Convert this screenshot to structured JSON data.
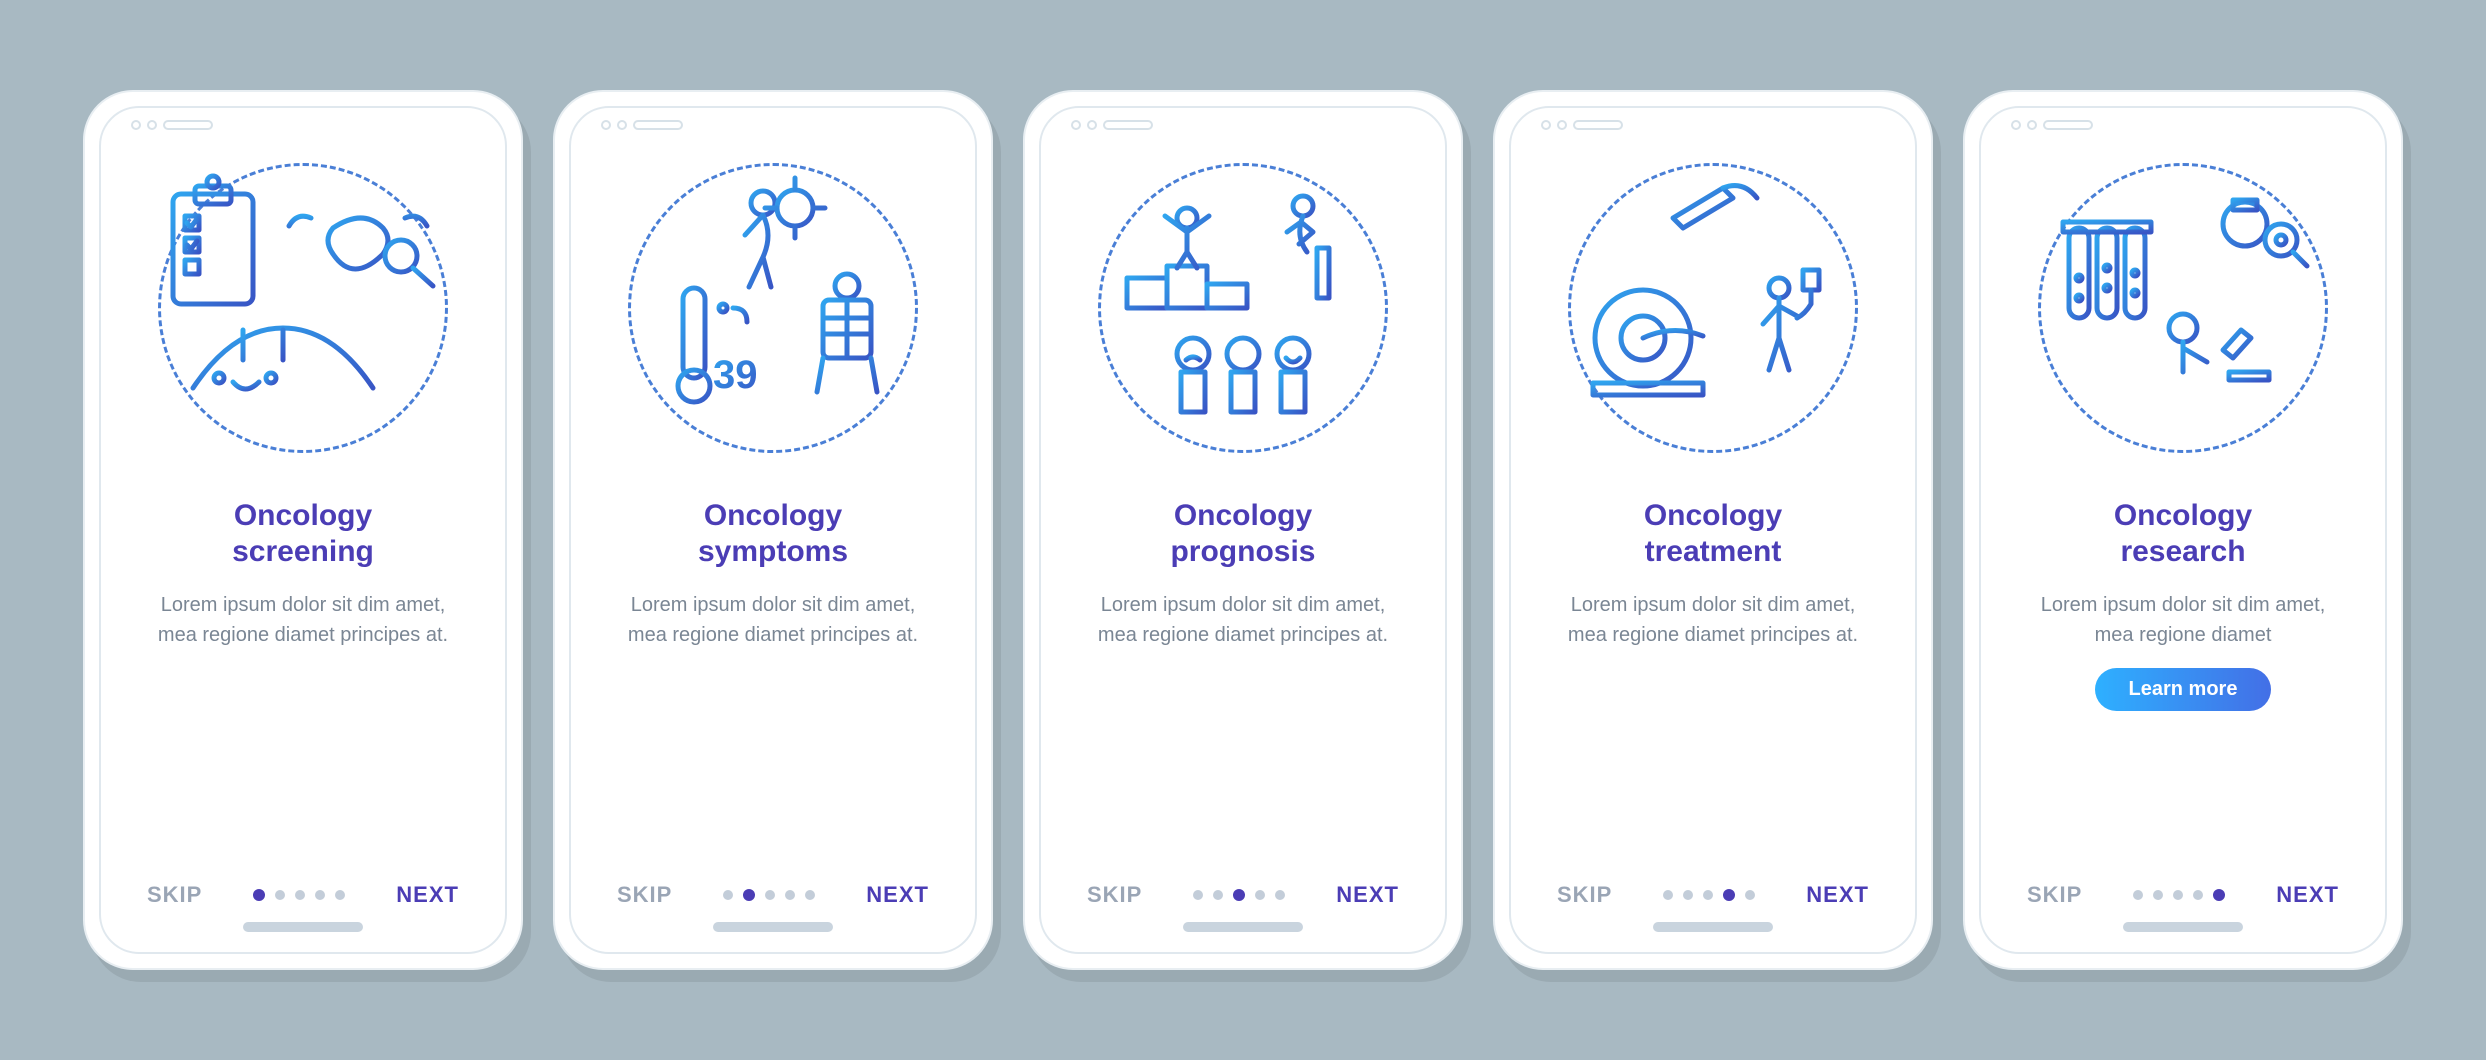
{
  "body_text": "Lorem ipsum dolor sit dim amet, mea regione diamet principes at.",
  "body_text_short": "Lorem ipsum dolor sit dim amet, mea regione diamet",
  "skip_label": "SKIP",
  "next_label": "NEXT",
  "learn_more_label": "Learn more",
  "screens": [
    {
      "title_l1": "Oncology",
      "title_l2": "screening"
    },
    {
      "title_l1": "Oncology",
      "title_l2": "symptoms"
    },
    {
      "title_l1": "Oncology",
      "title_l2": "prognosis"
    },
    {
      "title_l1": "Oncology",
      "title_l2": "treatment"
    },
    {
      "title_l1": "Oncology",
      "title_l2": "research"
    }
  ],
  "total_dots": 5
}
